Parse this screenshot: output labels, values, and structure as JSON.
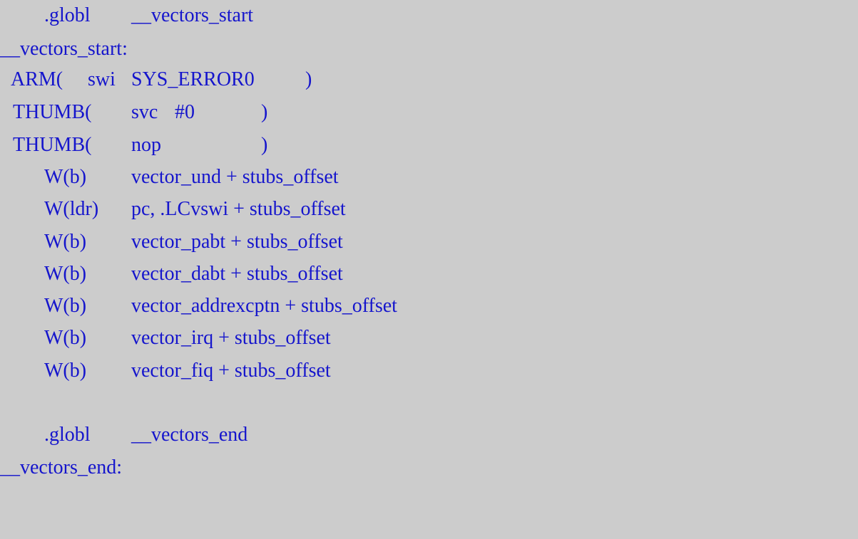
{
  "code": {
    "lines": [
      {
        "a": ".globl",
        "b": "__vectors_start"
      },
      {
        "a": "__vectors_start:"
      },
      {
        "a": "ARM(",
        "b": "swi",
        "c": "SYS_ERROR0",
        "d": ")"
      },
      {
        "a": "THUMB(",
        "b": "svc",
        "c": "#0",
        "d": ")"
      },
      {
        "a": "THUMB(",
        "b": "nop",
        "d": ")"
      },
      {
        "a": "W(b)",
        "b": "vector_und + stubs_offset"
      },
      {
        "a": "W(ldr)",
        "b": "pc, .LCvswi + stubs_offset"
      },
      {
        "a": "W(b)",
        "b": "vector_pabt + stubs_offset"
      },
      {
        "a": "W(b)",
        "b": "vector_dabt + stubs_offset"
      },
      {
        "a": "W(b)",
        "b": "vector_addrexcptn + stubs_offset"
      },
      {
        "a": "W(b)",
        "b": "vector_irq + stubs_offset"
      },
      {
        "a": "W(b)",
        "b": "vector_fiq + stubs_offset"
      },
      {
        "a": ".globl",
        "b": "__vectors_end"
      },
      {
        "a": "__vectors_end:"
      }
    ]
  },
  "colors": {
    "background": "#cccccc",
    "code_text": "#1515cc"
  }
}
